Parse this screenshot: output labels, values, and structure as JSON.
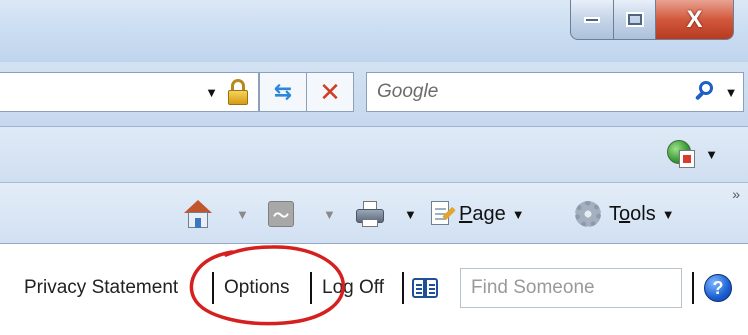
{
  "window_controls": {
    "minimize_icon": "minimize-icon",
    "maximize_icon": "maximize-icon",
    "close_icon": "close-icon",
    "close_glyph": "X"
  },
  "address_bar": {
    "dropdown_icon": "chevron-down-icon",
    "security_icon": "lock-icon",
    "refresh_icon": "refresh-icon",
    "stop_icon": "stop-icon",
    "dropdown_glyph": "▼",
    "refresh_glyph": "⇆",
    "stop_glyph": "✕"
  },
  "search": {
    "placeholder": "Google",
    "go_icon": "search-icon",
    "dropdown_glyph": "▼"
  },
  "favorites_bar": {
    "feed_icon": "web-slice-icon",
    "dropdown_glyph": "▼"
  },
  "command_bar": {
    "chevron_glyph": "»",
    "home_icon": "home-icon",
    "feeds_icon": "rss-feed-icon",
    "feeds_glyph": "〜",
    "print_icon": "printer-icon",
    "page_icon": "page-icon",
    "tools_icon": "gear-icon",
    "page_label_first": "P",
    "page_label_rest": "age",
    "tools_label_first": "T",
    "tools_label_u": "o",
    "tools_label_rest": "ols",
    "dropdown_glyph": "▼"
  },
  "site_links": {
    "privacy_statement": "Privacy Statement",
    "options": "Options",
    "log_off": "Log Off",
    "address_book_icon": "address-book-icon",
    "find_placeholder": "Find Someone",
    "help_icon": "help-icon",
    "help_glyph": "?"
  },
  "colors": {
    "annotation_circle": "#d62020",
    "close_button": "#c8472a",
    "help_button": "#1b5fd1"
  }
}
